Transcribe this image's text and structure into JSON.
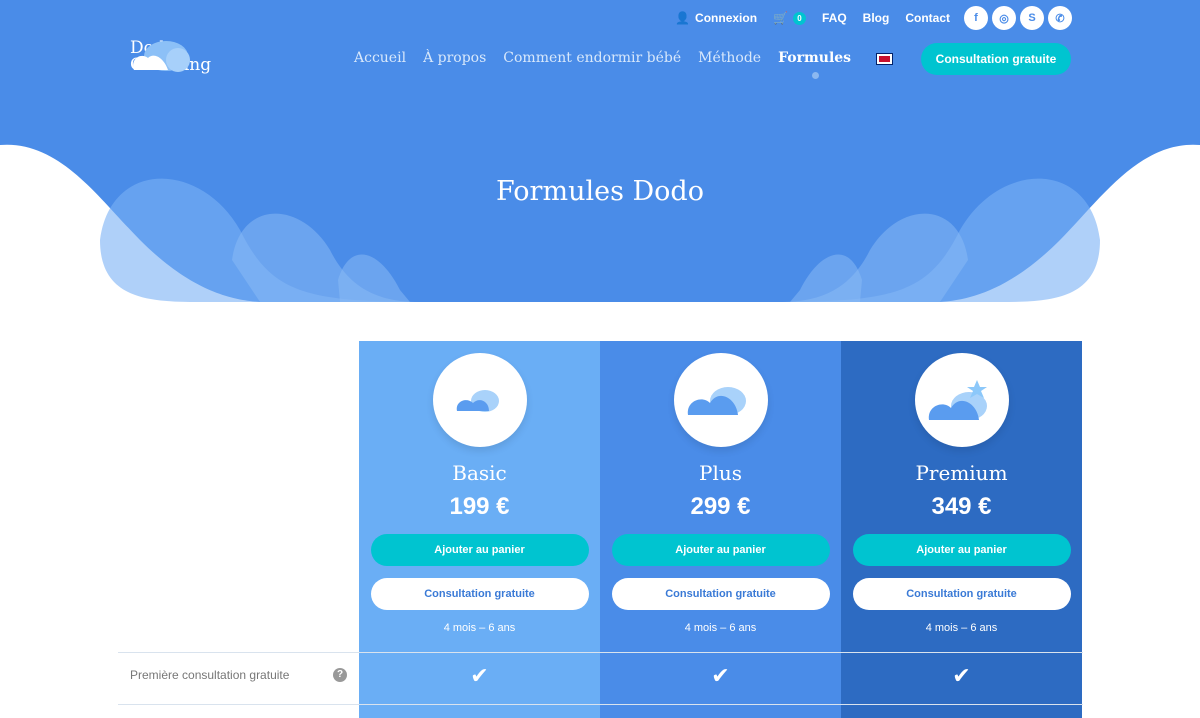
{
  "topbar": {
    "login": "Connexion",
    "cart_count": "0",
    "faq": "FAQ",
    "blog": "Blog",
    "contact": "Contact",
    "social": [
      "facebook-icon",
      "instagram-icon",
      "skype-icon",
      "whatsapp-icon"
    ]
  },
  "logo": {
    "line1": "Dodo",
    "line2": "Coaching"
  },
  "nav": [
    "Accueil",
    "À propos",
    "Comment endormir bébé",
    "Méthode",
    "Formules"
  ],
  "nav_active": "Formules",
  "cta": "Consultation gratuite",
  "page_title": "Formules Dodo",
  "colors": {
    "header": "#4a8ce8",
    "basic": "#6aaef5",
    "plus": "#4a8ce8",
    "premium": "#2d6bc2",
    "accent": "#00c4d0"
  },
  "plans": [
    {
      "name": "Basic",
      "price": "199 €",
      "add": "Ajouter au panier",
      "consult": "Consultation gratuite",
      "age": "4 mois – 6 ans"
    },
    {
      "name": "Plus",
      "price": "299 €",
      "add": "Ajouter au panier",
      "consult": "Consultation gratuite",
      "age": "4 mois – 6 ans"
    },
    {
      "name": "Premium",
      "price": "349 €",
      "add": "Ajouter au panier",
      "consult": "Consultation gratuite",
      "age": "4 mois – 6 ans"
    }
  ],
  "features": [
    {
      "label": "Première consultation gratuite",
      "basic": true,
      "plus": true,
      "premium": true
    }
  ]
}
